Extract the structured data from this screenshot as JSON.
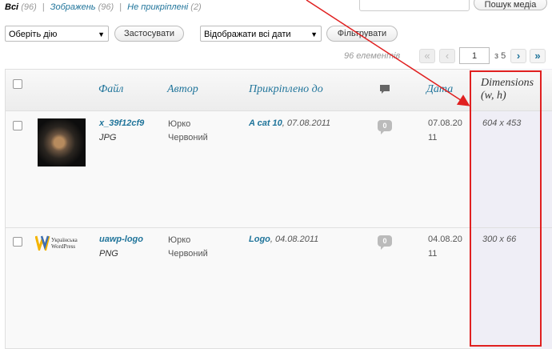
{
  "filters": {
    "all_label": "Всі",
    "all_count": "(96)",
    "images_label": "Зображень",
    "images_count": "(96)",
    "unattached_label": "Не прикріплені",
    "unattached_count": "(2)"
  },
  "search": {
    "button_label": "Пошук медіа"
  },
  "actions": {
    "bulk_select": "Оберіть дію",
    "apply_label": "Застосувати",
    "date_select": "Відображати всі дати",
    "filter_label": "Фільтрувати"
  },
  "pagination": {
    "items_text": "96 елементів",
    "first": "«",
    "prev": "‹",
    "current_page": "1",
    "of_text": "з 5",
    "next": "›",
    "last": "»"
  },
  "columns": {
    "file": "Файл",
    "author": "Автор",
    "attached": "Прикріплено до",
    "date": "Дата",
    "dimensions_line1": "Dimensions",
    "dimensions_line2": "(w, h)"
  },
  "rows": [
    {
      "title": "x_39f12cf9",
      "type": "JPG",
      "author_line1": "Юрко",
      "author_line2": "Червоний",
      "attached_title": "A cat 10",
      "attached_date": ", 07.08.2011",
      "comments": "0",
      "date_line1": "07.08.20",
      "date_line2": "11",
      "dimensions": "604 x 453"
    },
    {
      "title": "uawp-logo",
      "type": "PNG",
      "author_line1": "Юрко",
      "author_line2": "Червоний",
      "attached_title": "Logo",
      "attached_date": ", 04.08.2011",
      "comments": "0",
      "date_line1": "04.08.20",
      "date_line2": "11",
      "dimensions": "300 x 66",
      "logo_text_line1": "Українська",
      "logo_text_line2": "WordPress"
    }
  ],
  "colors": {
    "link": "#21759b",
    "annotation": "#e02020"
  }
}
